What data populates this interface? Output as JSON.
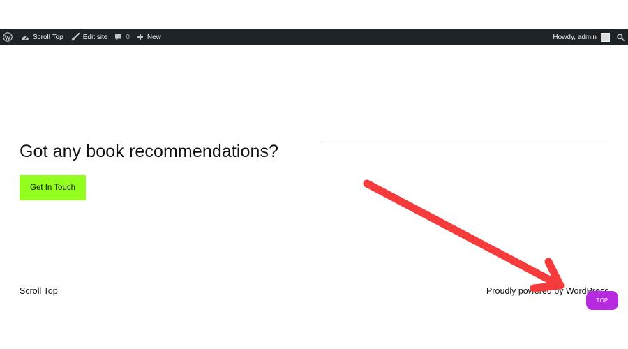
{
  "admin_bar": {
    "site_name": "Scroll Top",
    "edit_site": "Edit site",
    "comments_count": "0",
    "new_label": "New",
    "greeting": "Howdy, admin"
  },
  "cta": {
    "heading": "Got any book recommendations?",
    "button_label": "Get In Touch",
    "button_color": "#93ff1f"
  },
  "footer": {
    "site_title": "Scroll Top",
    "credit_prefix": "Proudly powered by ",
    "credit_link": "WordPress"
  },
  "scroll_top_button": {
    "label": "TOP",
    "color": "#b62ae0"
  },
  "annotation": {
    "arrow_color": "#f53b3b"
  },
  "colors": {
    "admin_bar_bg": "#1d2327",
    "page_bg": "#ffffff"
  }
}
